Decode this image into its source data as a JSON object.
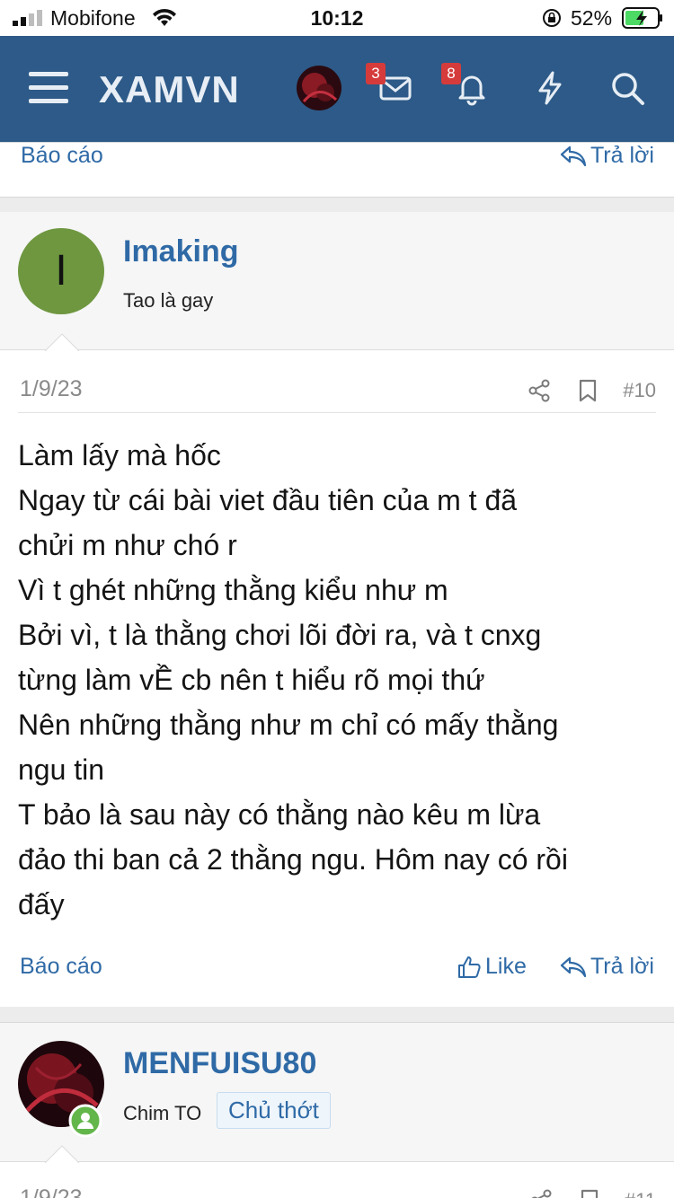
{
  "status_bar": {
    "carrier": "Mobifone",
    "time": "10:12",
    "battery": "52%"
  },
  "header": {
    "logo": "XAMVN",
    "messages_badge": "3",
    "alerts_badge": "8",
    "brand_color": "#2d5a88"
  },
  "prev_post": {
    "report": "Báo cáo",
    "reply": "Trả lời"
  },
  "post10": {
    "avatar_letter": "I",
    "username": "Imaking",
    "user_title": "Tao là gay",
    "date": "1/9/23",
    "number": "#10",
    "lines": [
      "Làm lấy mà hốc",
      "Ngay từ cái bài viet đầu tiên của m t đã",
      "chửi m như chó r",
      "Vì t ghét những thằng kiểu như m",
      "Bởi vì, t là thằng chơi lõi đời ra, và t cnxg",
      "từng làm vỀ cb nên t hiểu rõ mọi thứ",
      "Nên những thằng như m chỉ có mấy thằng",
      "ngu tin",
      "T bảo là sau này có thằng nào kêu m lừa",
      "đảo thi ban cả 2 thằng ngu. Hôm nay có rồi",
      "đấy"
    ],
    "report": "Báo cáo",
    "like": "Like",
    "reply": "Trả lời"
  },
  "post11": {
    "username": "MENFUISU80",
    "user_title": "Chim TO",
    "badge": "Chủ thớt",
    "date": "1/9/23",
    "number": "#11"
  }
}
